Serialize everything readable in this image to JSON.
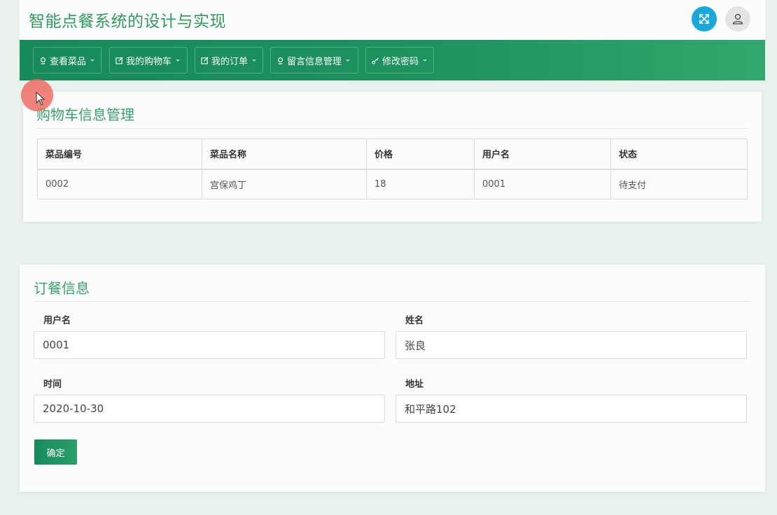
{
  "header": {
    "title": "智能点餐系统的设计与实现",
    "fullscreen_icon": "expand-arrows-icon",
    "user_icon": "user-icon"
  },
  "nav": {
    "items": [
      {
        "label": "查看菜品",
        "icon": "dish-icon"
      },
      {
        "label": "我的购物车",
        "icon": "edit-icon"
      },
      {
        "label": "我的订单",
        "icon": "edit-icon"
      },
      {
        "label": "留言信息管理",
        "icon": "dish-icon"
      },
      {
        "label": "修改密码",
        "icon": "key-icon"
      }
    ]
  },
  "cart": {
    "title": "购物车信息管理",
    "columns": [
      "菜品编号",
      "菜品名称",
      "价格",
      "用户名",
      "状态"
    ],
    "rows": [
      [
        "0002",
        "宫保鸡丁",
        "18",
        "0001",
        "待支付"
      ]
    ]
  },
  "order": {
    "title": "订餐信息",
    "fields": {
      "username": {
        "label": "用户名",
        "value": "0001"
      },
      "name": {
        "label": "姓名",
        "value": "张良"
      },
      "time": {
        "label": "时间",
        "value": "2020-10-30"
      },
      "address": {
        "label": "地址",
        "value": "和平路102"
      }
    },
    "confirm_label": "确定"
  },
  "colors": {
    "accent": "#2e9a5c",
    "nav_bg": "#1e9460",
    "fullscreen_btn": "#1aa7d9"
  }
}
